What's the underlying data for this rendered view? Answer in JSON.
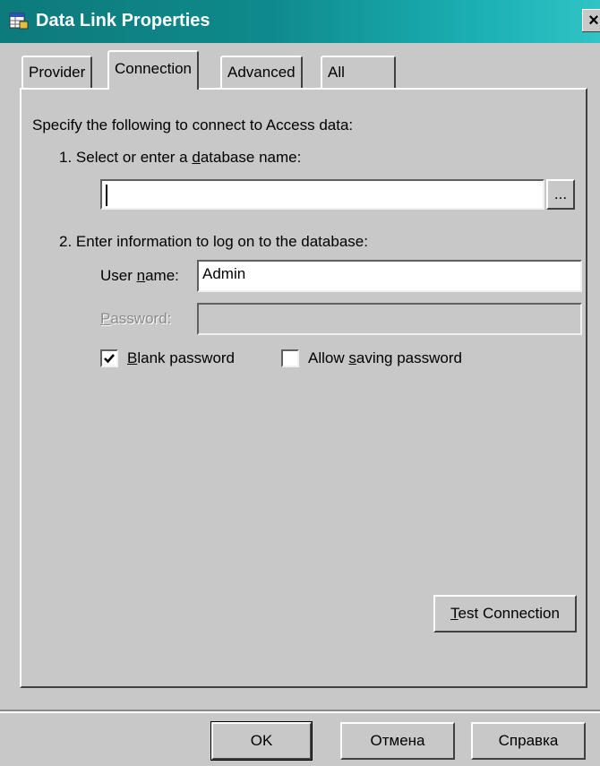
{
  "window": {
    "title": "Data Link Properties",
    "close_glyph": "×"
  },
  "tabs": [
    {
      "label": "Provider"
    },
    {
      "label": "Connection"
    },
    {
      "label": "Advanced"
    },
    {
      "label": "All"
    }
  ],
  "connection": {
    "intro": "Specify the following to connect to Access data:",
    "step1_pre": "1. Select or enter a ",
    "step1_u": "d",
    "step1_post": "atabase name:",
    "database_name": "",
    "browse_label": "...",
    "step2": "2. Enter information to log on to the database:",
    "username_pre": "User ",
    "username_u": "n",
    "username_post": "ame:",
    "username_value": "Admin",
    "password_u": "P",
    "password_post": "assword:",
    "password_value": "",
    "blank_password_u": "B",
    "blank_password_post": "lank password",
    "blank_password_checked": true,
    "allow_saving_pre": "Allow ",
    "allow_saving_u": "s",
    "allow_saving_post": "aving password",
    "allow_saving_checked": false,
    "test_u": "T",
    "test_post": "est Connection"
  },
  "footer": {
    "ok": "OK",
    "cancel": "Отмена",
    "help": "Справка"
  },
  "colors": {
    "title_gradient_start": "#0d7a7c",
    "title_gradient_end": "#30c4c6",
    "face": "#c8c8c8"
  }
}
